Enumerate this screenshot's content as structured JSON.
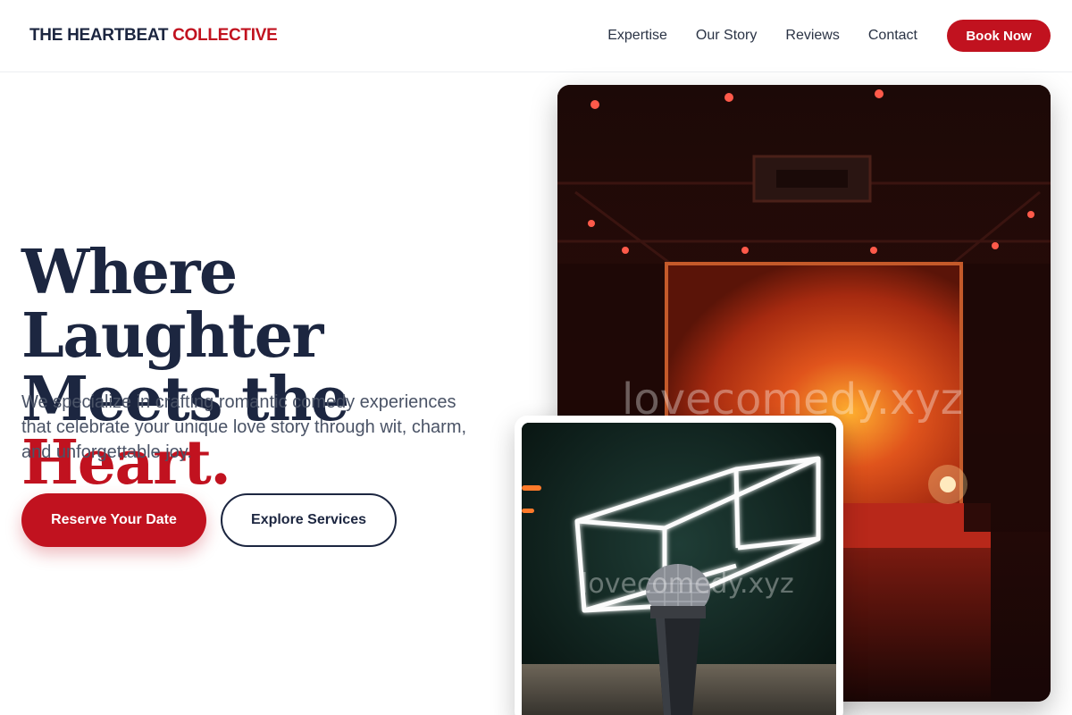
{
  "header": {
    "brand_main": "THE HEARTBEAT",
    "brand_accent": "COLLECTIVE",
    "nav": [
      "Expertise",
      "Our Story",
      "Reviews",
      "Contact"
    ],
    "book_label": "Book Now"
  },
  "hero": {
    "headline_line1": "Where Laughter",
    "headline_line2_start": "Meets the ",
    "headline_line2_accent": "Heart.",
    "subcopy": "We specialize in crafting romantic comedy experiences that celebrate your unique love story through wit, charm, and unforgettable joy.",
    "primary_cta": "Reserve Your Date",
    "secondary_cta": "Explore Services"
  },
  "images": {
    "main_alt": "Comedy stage with warm red lighting",
    "main_watermark": "lovecomedy.xyz",
    "secondary_alt": "Microphone in front of neon cube outline",
    "secondary_watermark": "lovecomedy.xyz"
  },
  "colors": {
    "accent": "#c1121f",
    "navy": "#1c2640"
  }
}
